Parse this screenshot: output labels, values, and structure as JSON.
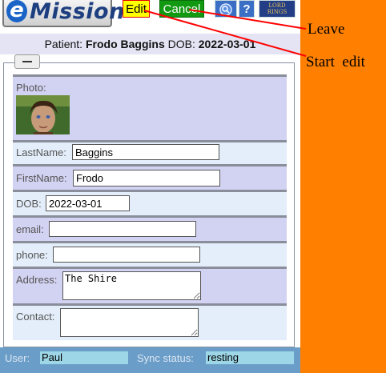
{
  "app": {
    "logo_letter": "e",
    "logo_text": "Mission"
  },
  "toolbar": {
    "edit_label": "Edit",
    "cancel_label": "Cancel",
    "search_icon": "magnifier-icon",
    "help_label": "?",
    "lotr_line1": "LORD",
    "lotr_line2": "RINGS"
  },
  "patient": {
    "prefix": "Patient:",
    "name": "Frodo Baggins",
    "dob_label": "DOB:",
    "dob": "2022-03-01"
  },
  "form": {
    "photo_label": "Photo:",
    "lastname_label": "LastName:",
    "lastname_value": "Baggins",
    "firstname_label": "FirstName:",
    "firstname_value": "Frodo",
    "dob_label": "DOB:",
    "dob_value": "2022-03-01",
    "email_label": "email:",
    "email_value": "",
    "phone_label": "phone:",
    "phone_value": "",
    "address_label": "Address:",
    "address_value": "The Shire",
    "contact_label": "Contact:",
    "contact_value": ""
  },
  "status": {
    "user_label": "User:",
    "user_value": "Paul",
    "sync_label": "Sync status:",
    "sync_value": "resting"
  },
  "annotations": {
    "leave": "Leave",
    "start_edit": "Start  edit",
    "line_color": "#ff0000"
  },
  "colors": {
    "side_panel": "#ff8000",
    "edit_button": "#ffff00",
    "cancel_button": "#119911",
    "statusbar": "#6a9ec8"
  }
}
